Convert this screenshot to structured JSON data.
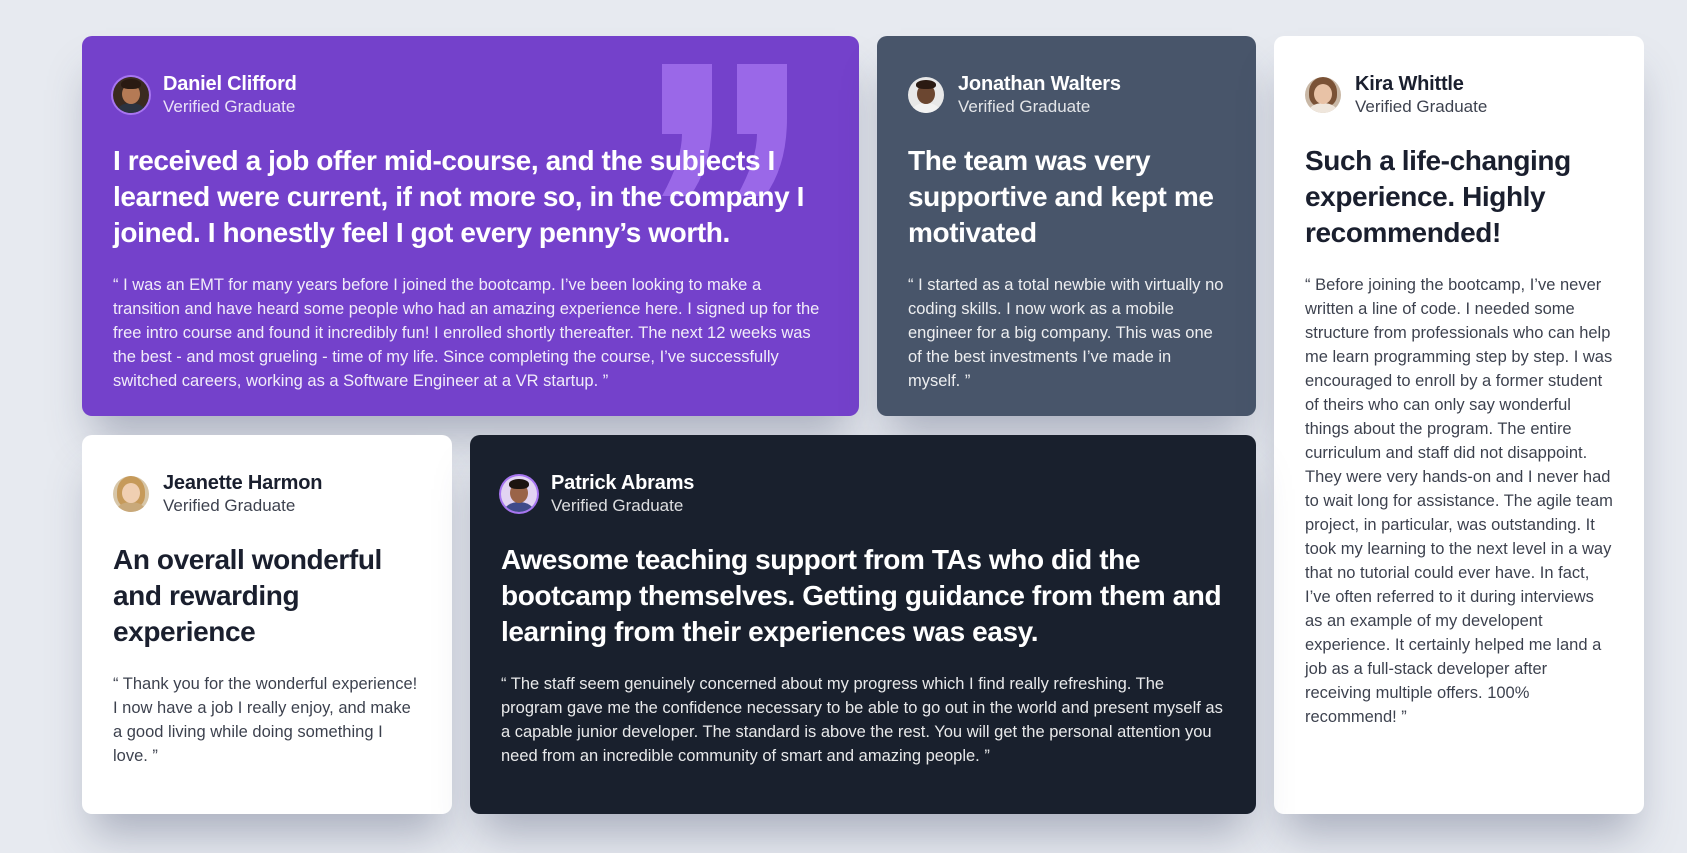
{
  "testimonials": [
    {
      "name": "Daniel Clifford",
      "role": "Verified Graduate",
      "avatar_icon": "man-avatar-icon",
      "title": "I received a job offer mid-course, and the subjects I learned were current, if not more so, in the company I joined. I honestly feel I got every penny’s worth.",
      "body": "“ I was an EMT for many years before I joined the bootcamp. I’ve been looking to make a transition and have heard some people who had an amazing experience here. I signed up for the free intro course and found it incredibly fun! I enrolled shortly thereafter. The next 12 weeks was the best - and most grueling - time of my life. Since completing the course, I’ve successfully switched careers, working as a Software Engineer at a VR startup. ”",
      "background": "#7441cb"
    },
    {
      "name": "Jonathan Walters",
      "role": "Verified Graduate",
      "avatar_icon": "man-avatar-icon",
      "title": "The team was very supportive and kept me motivated",
      "body": "“ I started as a total newbie with virtually no coding skills. I now work as a mobile engineer for a big company. This was one of the best investments I’ve made in myself. ”",
      "background": "#48556a"
    },
    {
      "name": "Kira Whittle",
      "role": "Verified Graduate",
      "avatar_icon": "woman-avatar-icon",
      "title": "Such a life-changing experience. Highly recommended!",
      "body": "“ Before joining the bootcamp, I’ve never written a line of code. I needed some structure from professionals who can help me learn programming step by step. I was encouraged to enroll by a former student of theirs who can only say wonderful things about the program. The entire curriculum and staff did not disappoint. They were very hands-on and I never had to wait long for assistance. The agile team project, in particular, was outstanding. It took my learning to the next level in a way that no tutorial could ever have. In fact, I’ve often referred to it during interviews as an example of my developent experience. It certainly helped me land a job as a full-stack developer after receiving multiple offers. 100% recommend! ”",
      "background": "#ffffff"
    },
    {
      "name": "Jeanette Harmon",
      "role": "Verified Graduate",
      "avatar_icon": "woman-avatar-icon",
      "title": "An overall wonderful and rewarding experience",
      "body": "“ Thank you for the wonderful experience! I now have a job I really enjoy, and make a good living while doing something I love. ”",
      "background": "#ffffff"
    },
    {
      "name": "Patrick Abrams",
      "role": "Verified Graduate",
      "avatar_icon": "man-avatar-icon",
      "title": "Awesome teaching support from TAs who did the bootcamp themselves. Getting guidance from them and learning from their experiences was easy.",
      "body": "“ The staff seem genuinely concerned about my progress which I find really refreshing. The program gave me the confidence necessary to be able to go out in the world and present myself as a capable junior developer. The standard is above the rest. You will get the personal attention you need from an incredible community of smart and amazing people. ”",
      "background": "#19202d"
    }
  ],
  "colors": {
    "page_background": "#e7eaf0",
    "quote_mark": "#a775f1",
    "dark_text": "#1a1f2e"
  }
}
